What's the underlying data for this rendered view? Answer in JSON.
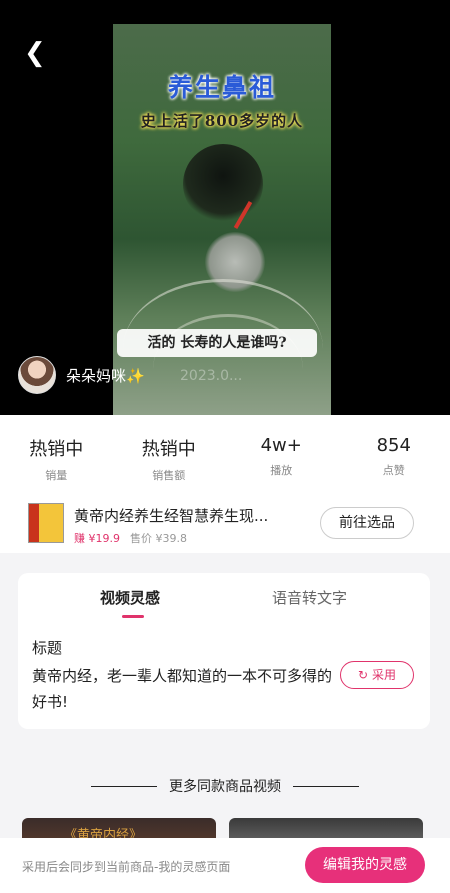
{
  "video": {
    "title": "养生鼻祖",
    "subtitle": "史上活了800多岁的人",
    "question": "活的 长寿的人是谁吗?",
    "author": "朵朵妈咪✨",
    "watermark": "2023.0..."
  },
  "stats": [
    {
      "value": "热销中",
      "label": "销量"
    },
    {
      "value": "热销中",
      "label": "销售额"
    },
    {
      "value": "4w+",
      "label": "播放"
    },
    {
      "value": "854",
      "label": "点赞"
    }
  ],
  "product": {
    "name": "黄帝内经养生经智慧养生现...",
    "earn": "赚 ¥19.9",
    "price": "售价 ¥39.8",
    "button": "前往选品"
  },
  "tabs": [
    "视频灵感",
    "语音转文字"
  ],
  "inspiration": {
    "heading": "标题",
    "text": "黄帝内经，老一辈人都知道的一本不可多得的好书!",
    "adopt_label": "采用"
  },
  "more": {
    "title": "更多同款商品视频",
    "thumb1_text": "《黄帝内经》"
  },
  "footer": {
    "hint": "采用后会同步到当前商品-我的灵感页面",
    "button": "编辑我的灵感"
  },
  "colors": {
    "accent": "#e7307a"
  }
}
